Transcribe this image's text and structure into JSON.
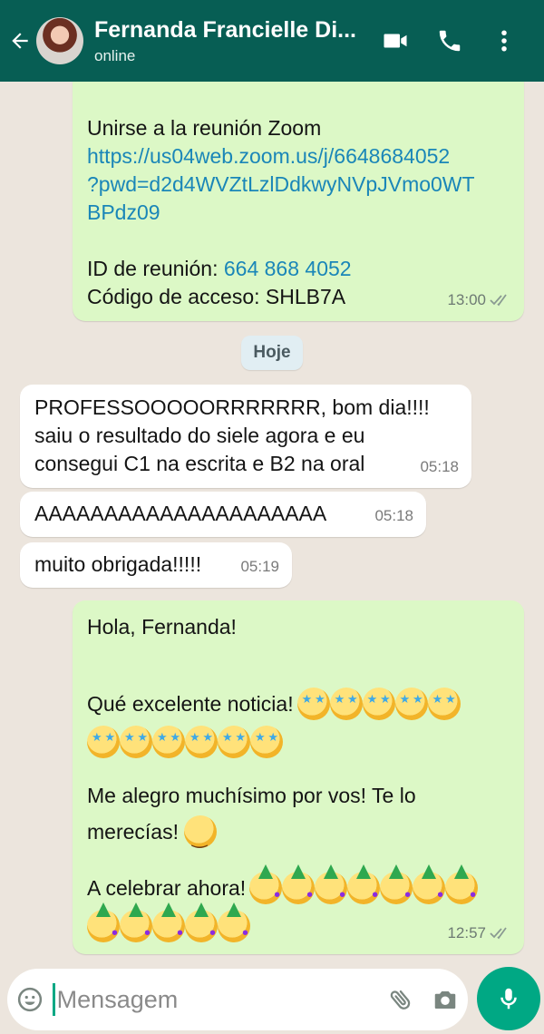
{
  "header": {
    "contact_name": "Fernanda Francielle Di...",
    "status": "online"
  },
  "messages": {
    "zoom": {
      "line1": "Unirse a la reunión Zoom",
      "url": "https://us04web.zoom.us/j/6648684052?pwd=d2d4WVZtLzlDdkwyNVpJVmo0WTBPdz09",
      "url_line1": "https://us04web.zoom.us/j/6648684052",
      "url_line2": "?pwd=d2d4WVZtLzlDdkwyNVpJVmo0WT",
      "url_line3": "BPdz09",
      "id_label": "ID de reunión: ",
      "id_value": "664 868 4052",
      "code_line": "Código de acceso: SHLB7A",
      "time": "13:00"
    },
    "date_chip": "Hoje",
    "in1": {
      "line1": "PROFESSOOOOORRRRRRR, bom dia!!!!",
      "line2": "saiu o resultado do siele agora e eu",
      "line3": "consegui C1 na escrita e B2 na oral",
      "time": "05:18"
    },
    "in2": {
      "text": "AAAAAAAAAAAAAAAAAAAAA",
      "time": "05:18"
    },
    "in3": {
      "text": "muito obrigada!!!!!",
      "time": "05:19"
    },
    "reply": {
      "greeting": "Hola, Fernanda!",
      "news": "Qué excelente noticia!",
      "glad_line1": "Me alegro muchísimo por vos! Te lo",
      "glad_line2": "merecías!",
      "celebrate": "A celebrar ahora!",
      "time": "12:57",
      "star_emoji": "star-struck-emoji",
      "smile_emoji": "smiling-face-emoji",
      "party_emoji": "partying-face-emoji"
    }
  },
  "composer": {
    "placeholder": "Mensagem"
  },
  "colors": {
    "header": "#075e54",
    "outgoing": "#dcf8c6",
    "incoming": "#ffffff",
    "link": "#1a86b8",
    "accent": "#00a884"
  }
}
